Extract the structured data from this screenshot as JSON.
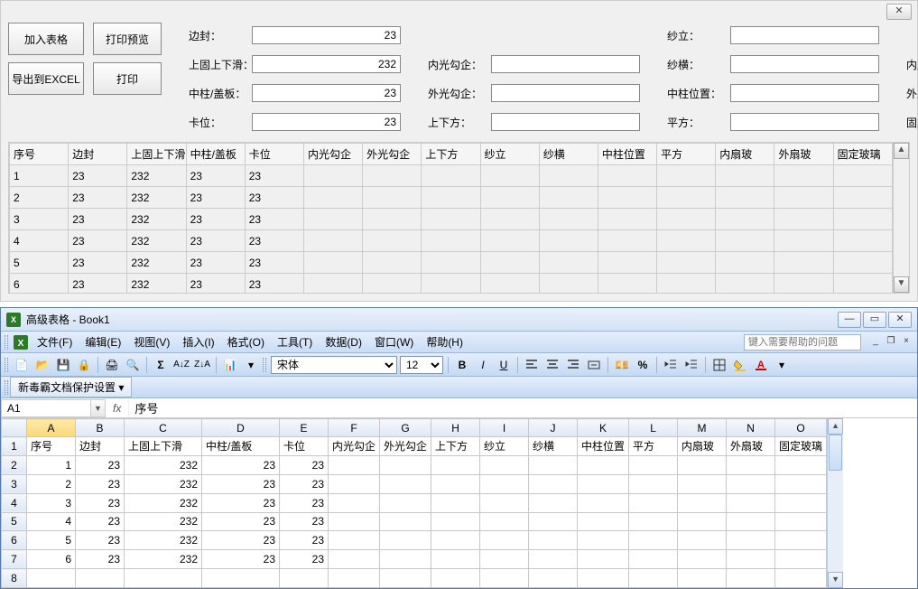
{
  "top": {
    "buttons": {
      "add_table": "加入表格",
      "print_preview": "打印预览",
      "export_excel": "导出到EXCEL",
      "print": "打印"
    },
    "fields": {
      "bianfeng": {
        "label": "边封：",
        "value": "23"
      },
      "shangguxia": {
        "label": "上固上下滑：",
        "value": "232"
      },
      "zhongzhu_gaiban": {
        "label": "中柱/盖板：",
        "value": "23"
      },
      "kawei": {
        "label": "卡位：",
        "value": "23"
      },
      "neiguang": {
        "label": "内光勾企：",
        "value": ""
      },
      "waiguang": {
        "label": "外光勾企：",
        "value": ""
      },
      "shangxiafang": {
        "label": "上下方：",
        "value": ""
      },
      "shali": {
        "label": "纱立：",
        "value": ""
      },
      "shaheng": {
        "label": "纱横：",
        "value": ""
      },
      "zhongzhu_pos": {
        "label": "中柱位置：",
        "value": ""
      },
      "pingfang": {
        "label": "平方：",
        "value": ""
      },
      "neishanbo": {
        "label": "内扇玻：",
        "value": ""
      },
      "waishanbo": {
        "label": "外扇玻：",
        "value": ""
      },
      "guding_boli": {
        "label": "固定玻璃：",
        "value": ""
      }
    }
  },
  "grid": {
    "headers": [
      "序号",
      "边封",
      "上固上下滑",
      "中柱/盖板",
      "卡位",
      "内光勾企",
      "外光勾企",
      "上下方",
      "纱立",
      "纱横",
      "中柱位置",
      "平方",
      "内扇玻",
      "外扇玻",
      "固定玻璃"
    ],
    "rows": [
      [
        "1",
        "23",
        "232",
        "23",
        "23",
        "",
        "",
        "",
        "",
        "",
        "",
        "",
        "",
        "",
        ""
      ],
      [
        "2",
        "23",
        "232",
        "23",
        "23",
        "",
        "",
        "",
        "",
        "",
        "",
        "",
        "",
        "",
        ""
      ],
      [
        "3",
        "23",
        "232",
        "23",
        "23",
        "",
        "",
        "",
        "",
        "",
        "",
        "",
        "",
        "",
        ""
      ],
      [
        "4",
        "23",
        "232",
        "23",
        "23",
        "",
        "",
        "",
        "",
        "",
        "",
        "",
        "",
        "",
        ""
      ],
      [
        "5",
        "23",
        "232",
        "23",
        "23",
        "",
        "",
        "",
        "",
        "",
        "",
        "",
        "",
        "",
        ""
      ],
      [
        "6",
        "23",
        "232",
        "23",
        "23",
        "",
        "",
        "",
        "",
        "",
        "",
        "",
        "",
        "",
        ""
      ]
    ]
  },
  "excel": {
    "title": "高级表格 - Book1",
    "menus": {
      "file": "文件(F)",
      "edit": "编辑(E)",
      "view": "视图(V)",
      "insert": "插入(I)",
      "format": "格式(O)",
      "tools": "工具(T)",
      "data": "数据(D)",
      "window": "窗口(W)",
      "help": "帮助(H)"
    },
    "help_placeholder": "键入需要帮助的问题",
    "font_name": "宋体",
    "font_size": "12",
    "protect_label": "新毒霸文档保护设置",
    "name_box": "A1",
    "formula_value": "序号",
    "columns": [
      "A",
      "B",
      "C",
      "D",
      "E",
      "F",
      "G",
      "H",
      "I",
      "J",
      "K",
      "L",
      "M",
      "N",
      "O"
    ],
    "col_headers_row": [
      "序号",
      "边封",
      "上固上下滑",
      "中柱/盖板",
      "卡位",
      "内光勾企",
      "外光勾企",
      "上下方",
      "纱立",
      "纱横",
      "中柱位置",
      "平方",
      "内扇玻",
      "外扇玻",
      "固定玻璃"
    ],
    "data_rows": [
      [
        "1",
        "23",
        "232",
        "23",
        "23",
        "",
        "",
        "",
        "",
        "",
        "",
        "",
        "",
        "",
        ""
      ],
      [
        "2",
        "23",
        "232",
        "23",
        "23",
        "",
        "",
        "",
        "",
        "",
        "",
        "",
        "",
        "",
        ""
      ],
      [
        "3",
        "23",
        "232",
        "23",
        "23",
        "",
        "",
        "",
        "",
        "",
        "",
        "",
        "",
        "",
        ""
      ],
      [
        "4",
        "23",
        "232",
        "23",
        "23",
        "",
        "",
        "",
        "",
        "",
        "",
        "",
        "",
        "",
        ""
      ],
      [
        "5",
        "23",
        "232",
        "23",
        "23",
        "",
        "",
        "",
        "",
        "",
        "",
        "",
        "",
        "",
        ""
      ],
      [
        "6",
        "23",
        "232",
        "23",
        "23",
        "",
        "",
        "",
        "",
        "",
        "",
        "",
        "",
        "",
        ""
      ]
    ]
  }
}
